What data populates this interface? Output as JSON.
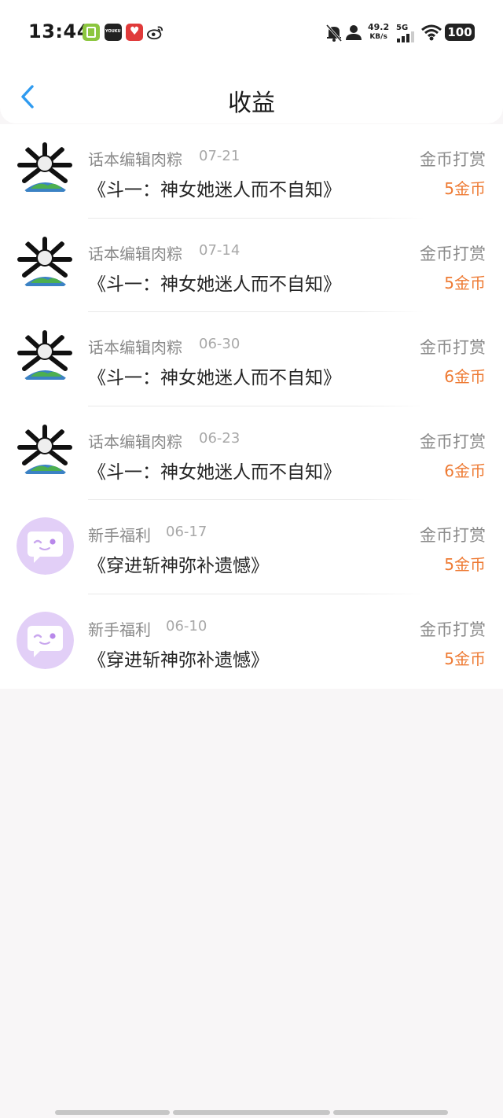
{
  "status_bar": {
    "time": "13:44",
    "net_speed_value": "49.2",
    "net_speed_unit": "KB/s",
    "network_type": "5G",
    "battery": "100",
    "icons": [
      "notes-app-icon",
      "youku-app-icon",
      "red-heart-app-icon",
      "weibo-icon",
      "bell-muted-icon",
      "user-icon",
      "signal-icon",
      "wifi-icon",
      "battery-icon"
    ]
  },
  "header": {
    "back_icon": "chevron-left-icon",
    "title": "收益"
  },
  "colors": {
    "accent": "#2f9bf0",
    "amount": "#ee7a33",
    "muted_text": "#8a8a8a",
    "avatar_purple": "#e2cff7"
  },
  "records": [
    {
      "author": "话本编辑肉粽",
      "date": "07-21",
      "book": "《斗一：神女她迷人而不自知》",
      "type": "金币打赏",
      "amount": "5金币",
      "avatar": "editor-avatar"
    },
    {
      "author": "话本编辑肉粽",
      "date": "07-14",
      "book": "《斗一：神女她迷人而不自知》",
      "type": "金币打赏",
      "amount": "5金币",
      "avatar": "editor-avatar"
    },
    {
      "author": "话本编辑肉粽",
      "date": "06-30",
      "book": "《斗一：神女她迷人而不自知》",
      "type": "金币打赏",
      "amount": "6金币",
      "avatar": "editor-avatar"
    },
    {
      "author": "话本编辑肉粽",
      "date": "06-23",
      "book": "《斗一：神女她迷人而不自知》",
      "type": "金币打赏",
      "amount": "6金币",
      "avatar": "editor-avatar"
    },
    {
      "author": "新手福利",
      "date": "06-17",
      "book": "《穿进斩神弥补遗憾》",
      "type": "金币打赏",
      "amount": "5金币",
      "avatar": "chat-bubble-avatar"
    },
    {
      "author": "新手福利",
      "date": "06-10",
      "book": "《穿进斩神弥补遗憾》",
      "type": "金币打赏",
      "amount": "5金币",
      "avatar": "chat-bubble-avatar"
    }
  ]
}
